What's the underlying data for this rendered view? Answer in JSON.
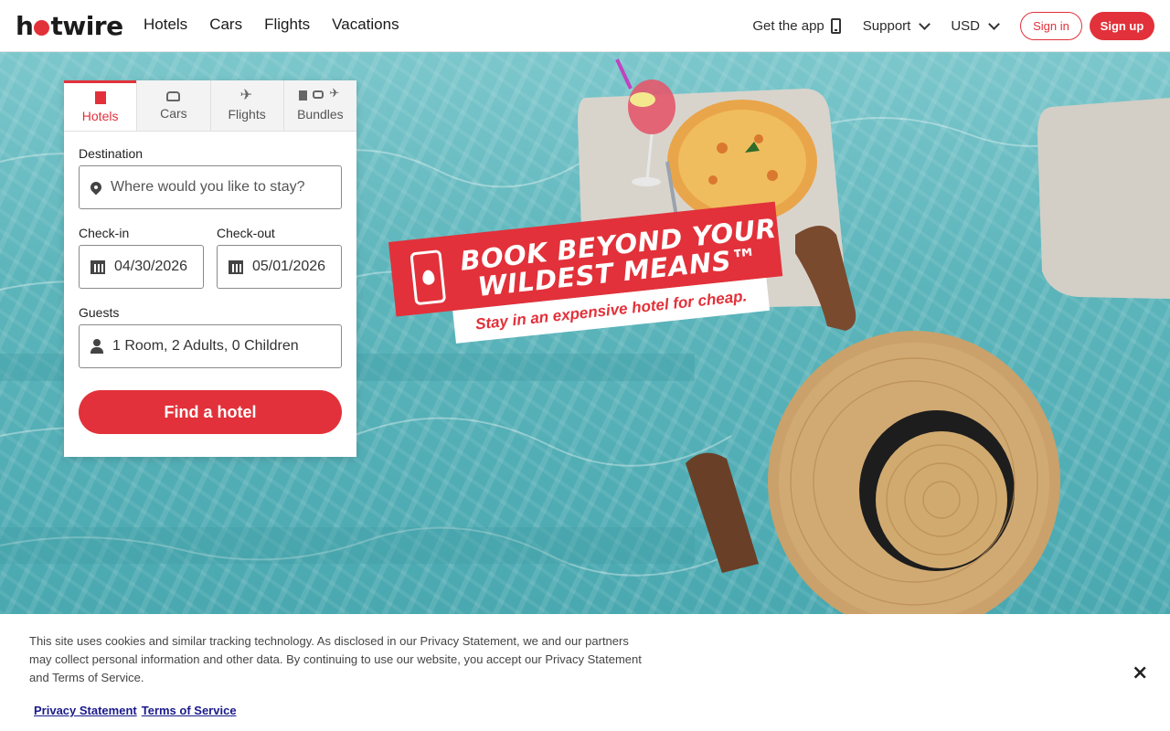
{
  "header": {
    "logo": {
      "part1": "h",
      "part2": "twire"
    },
    "nav": [
      "Hotels",
      "Cars",
      "Flights",
      "Vacations"
    ],
    "get_app": "Get the app",
    "support": "Support",
    "currency": "USD",
    "sign_in": "Sign in",
    "sign_up": "Sign up"
  },
  "search": {
    "tabs": [
      "Hotels",
      "Cars",
      "Flights",
      "Bundles"
    ],
    "active_tab": "Hotels",
    "destination_label": "Destination",
    "destination_placeholder": "Where would you like to stay?",
    "checkin_label": "Check-in",
    "checkin_value": "04/30/2026",
    "checkout_label": "Check-out",
    "checkout_value": "05/01/2026",
    "guests_label": "Guests",
    "guests_value": "1 Room, 2 Adults, 0 Children",
    "submit": "Find a hotel"
  },
  "banner": {
    "line1": "BOOK BEYOND YOUR",
    "line2": "WILDEST MEANS™",
    "subline": "Stay in an expensive hotel for cheap."
  },
  "cookie": {
    "text": "This site uses cookies and similar tracking technology. As disclosed in our Privacy Statement, we and our partners may collect personal information and other data. By continuing to use our website, you accept our Privacy Statement and Terms of Service.",
    "privacy_link": "Privacy Statement",
    "terms_link": "Terms of Service",
    "close": "×"
  },
  "colors": {
    "brand_red": "#e2313a",
    "water": "#5cb5bb"
  },
  "icons": [
    "hotel-icon",
    "car-icon",
    "plane-icon",
    "phone-icon",
    "map-pin-icon",
    "calendar-icon",
    "person-icon",
    "close-icon",
    "chevron-down-icon"
  ]
}
